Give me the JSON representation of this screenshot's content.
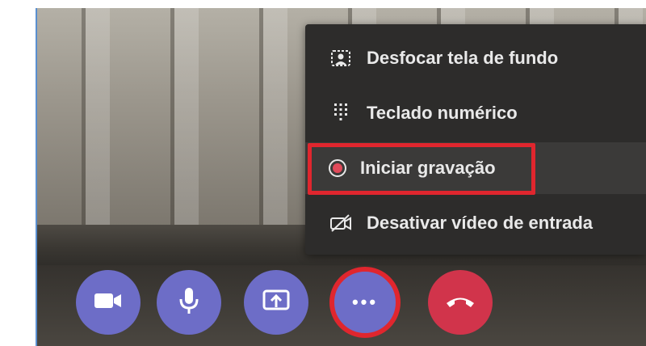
{
  "menu": {
    "items": [
      {
        "label": "Desfocar tela de fundo",
        "icon": "blur-background-icon"
      },
      {
        "label": "Teclado numérico",
        "icon": "dialpad-icon"
      },
      {
        "label": "Iniciar gravação",
        "icon": "record-icon"
      },
      {
        "label": "Desativar vídeo de entrada",
        "icon": "video-off-icon"
      }
    ]
  },
  "call_controls": [
    {
      "name": "camera-button",
      "icon": "camera-icon"
    },
    {
      "name": "microphone-button",
      "icon": "microphone-icon"
    },
    {
      "name": "share-screen-button",
      "icon": "share-screen-icon"
    },
    {
      "name": "more-actions-button",
      "icon": "ellipsis-icon",
      "symbol": "•••"
    },
    {
      "name": "hang-up-button",
      "icon": "phone-hangup-icon"
    }
  ],
  "colors": {
    "accent_purple": "#6d6dc7",
    "hangup_red": "#d1344b",
    "highlight_red": "#e0262e",
    "menu_background": "#2d2c2b",
    "record_dot": "#e04a5a"
  }
}
